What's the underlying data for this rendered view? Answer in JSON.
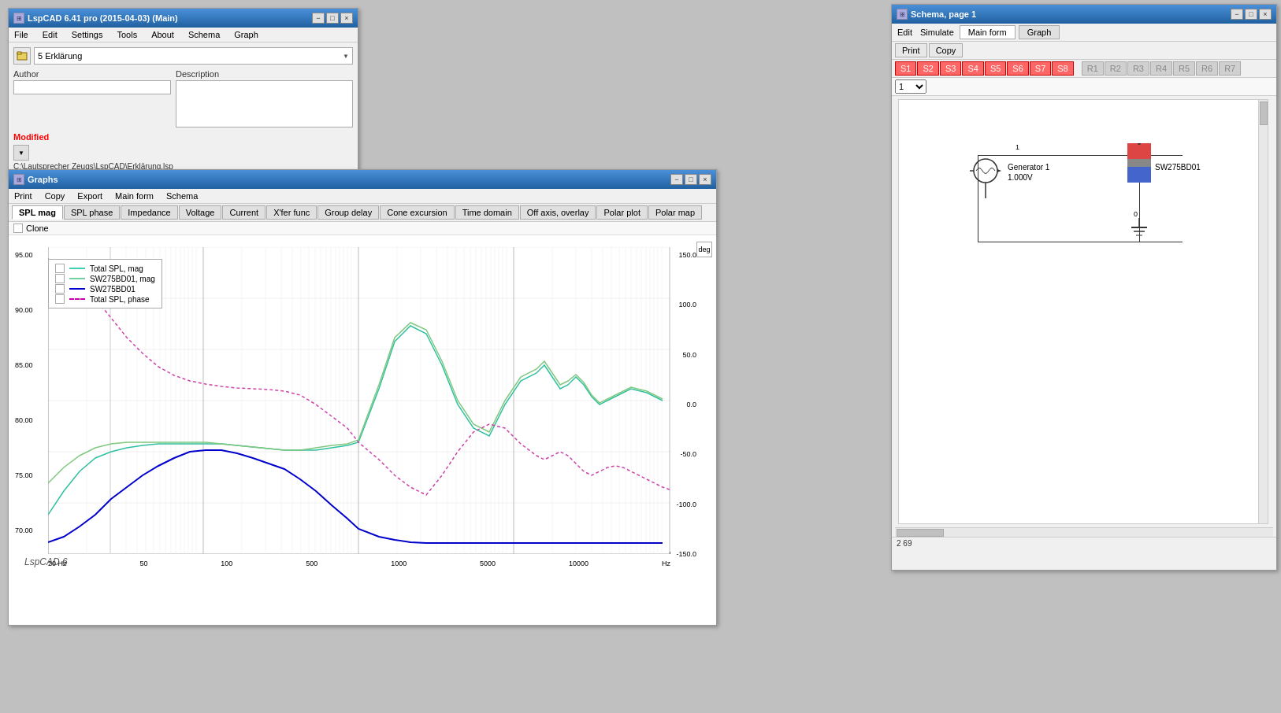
{
  "main_window": {
    "title": "LspCAD 6.41 pro (2015-04-03) (Main)",
    "menu": [
      "File",
      "Edit",
      "Settings",
      "Tools",
      "About",
      "Schema",
      "Graph"
    ],
    "dropdown_value": "5 Erklärung",
    "author_label": "Author",
    "description_label": "Description",
    "modified_text": "Modified",
    "file_path": "C:\\Lautsprecher Zeugs\\LspCAD\\Erklärung.lsp",
    "controls": [
      "−",
      "□",
      "×"
    ]
  },
  "graphs_window": {
    "title": "Graphs",
    "menu": [
      "Print",
      "Copy",
      "Export",
      "Main form",
      "Schema"
    ],
    "tabs": [
      "SPL mag",
      "SPL phase",
      "Impedance",
      "Voltage",
      "Current",
      "X'fer func",
      "Group delay",
      "Cone excursion",
      "Time domain",
      "Off axis, overlay",
      "Polar plot",
      "Polar map"
    ],
    "active_tab": "SPL mag",
    "clone_label": "Clone",
    "deg_label": "deg",
    "hz_label": "Hz",
    "legend": [
      {
        "label": "Total SPL, mag",
        "color": "#40d0b0",
        "style": "solid"
      },
      {
        "label": "SW275BD01, mag",
        "color": "#70d0a0",
        "style": "solid"
      },
      {
        "label": "SW275BD01",
        "color": "#0000cc",
        "style": "solid"
      },
      {
        "label": "Total SPL, phase",
        "color": "#cc00aa",
        "style": "dashed"
      }
    ],
    "y_left_labels": [
      "95.00",
      "90.00",
      "85.00",
      "80.00",
      "75.00",
      "70.00"
    ],
    "y_right_labels": [
      "150.0",
      "100.0",
      "50.0",
      "0.0",
      "-50.0",
      "-100.0",
      "-150.0"
    ],
    "x_labels": [
      "20 Hz",
      "50",
      "100",
      "500",
      "1000",
      "5000",
      "10000"
    ],
    "watermark": "LspCAD 6",
    "controls": [
      "−",
      "□",
      "×"
    ]
  },
  "schema_window": {
    "title": "Schema, page 1",
    "menu_items": [
      "Edit",
      "Simulate"
    ],
    "main_form_tab": "Main form",
    "graph_tab": "Graph",
    "print_btn": "Print",
    "copy_btn": "Copy",
    "s_tabs_active": [
      "S1",
      "S2",
      "S3",
      "S4",
      "S5",
      "S6",
      "S7",
      "S8"
    ],
    "s_tabs_inactive": [
      "R1",
      "R2",
      "R3",
      "R4",
      "R5",
      "R6",
      "R7"
    ],
    "page_number": "1",
    "generator_label": "Generator 1",
    "generator_voltage": "1.000V",
    "component_label": "SW275BD01",
    "status_text": "2 69",
    "controls": [
      "−",
      "□",
      "×"
    ]
  }
}
